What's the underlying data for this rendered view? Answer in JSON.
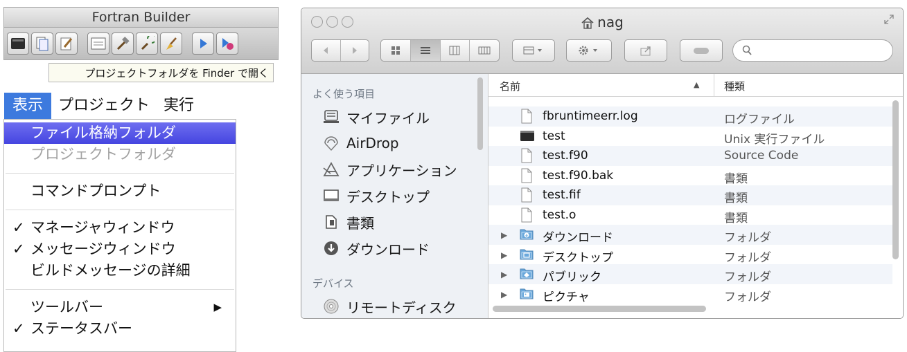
{
  "fortran_builder": {
    "title": "Fortran Builder",
    "tooltip": "プロジェクトフォルダを Finder で開く",
    "toolbar_icons": [
      "terminal-icon",
      "documents-icon",
      "settings-icon",
      "window-icon",
      "hammer-icon",
      "build-tools-icon",
      "broom-icon",
      "run-icon",
      "run-debug-icon"
    ]
  },
  "menu": {
    "menubar": [
      "表示",
      "プロジェクト",
      "実行"
    ],
    "items": [
      {
        "label": "ファイル格納フォルダ",
        "state": "selected"
      },
      {
        "label": "プロジェクトフォルダ",
        "state": "disabled"
      },
      {
        "sep": true
      },
      {
        "label": "コマンドプロンプト"
      },
      {
        "sep": true
      },
      {
        "label": "マネージャウィンドウ",
        "check": "✓"
      },
      {
        "label": "メッセージウィンドウ",
        "check": "✓"
      },
      {
        "label": "ビルドメッセージの詳細"
      },
      {
        "sep": true
      },
      {
        "label": "ツールバー",
        "arrow": "▶"
      },
      {
        "label": "ステータスバー",
        "check": "✓"
      }
    ]
  },
  "finder": {
    "title": "nag",
    "search": {
      "value": "",
      "placeholder": ""
    },
    "sidebar": {
      "favorites_heading": "よく使う項目",
      "devices_heading": "デバイス",
      "items": [
        {
          "label": "マイファイル",
          "icon": "my-files-icon"
        },
        {
          "label": "AirDrop",
          "icon": "airdrop-icon"
        },
        {
          "label": "アプリケーション",
          "icon": "applications-icon"
        },
        {
          "label": "デスクトップ",
          "icon": "desktop-icon"
        },
        {
          "label": "書類",
          "icon": "documents-icon"
        },
        {
          "label": "ダウンロード",
          "icon": "downloads-icon"
        }
      ],
      "devices": [
        {
          "label": "リモートディスク",
          "icon": "remote-disc-icon"
        }
      ]
    },
    "columns": {
      "name": "名前",
      "sort": "▲",
      "kind": "種類"
    },
    "files": [
      {
        "name": "fbruntimeerr.log",
        "kind": "ログファイル",
        "type": "file"
      },
      {
        "name": "test",
        "kind": "Unix 実行ファイル",
        "type": "exec"
      },
      {
        "name": "test.f90",
        "kind": "Source Code",
        "type": "file"
      },
      {
        "name": "test.f90.bak",
        "kind": "書類",
        "type": "file"
      },
      {
        "name": "test.fif",
        "kind": "書類",
        "type": "file"
      },
      {
        "name": "test.o",
        "kind": "書類",
        "type": "file"
      },
      {
        "name": "ダウンロード",
        "kind": "フォルダ",
        "type": "folder",
        "folder_icon": "downloads"
      },
      {
        "name": "デスクトップ",
        "kind": "フォルダ",
        "type": "folder",
        "folder_icon": "desktop"
      },
      {
        "name": "パブリック",
        "kind": "フォルダ",
        "type": "folder",
        "folder_icon": "public"
      },
      {
        "name": "ピクチャ",
        "kind": "フォルダ",
        "type": "folder",
        "folder_icon": "pictures"
      }
    ],
    "disclosure_glyph": "▶"
  },
  "colors": {
    "menu_highlight": "#3d7ade",
    "selected_item": "#4a4ae4",
    "folder_blue": "#6aa8dc"
  }
}
